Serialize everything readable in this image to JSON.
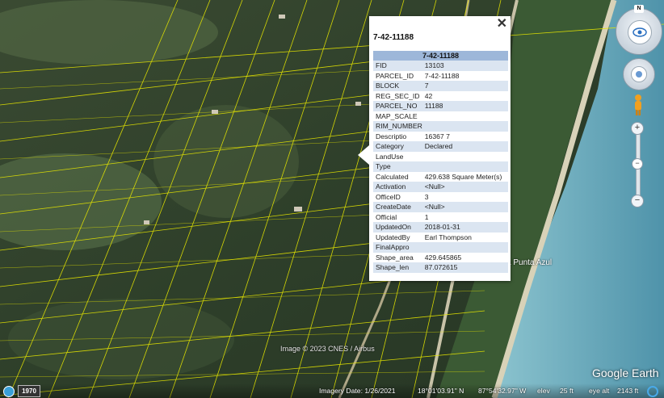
{
  "popup": {
    "heading": "7-42-11188",
    "table_header": "7-42-11188",
    "close_label": "✕",
    "rows": [
      {
        "key": "FID",
        "value": "13103"
      },
      {
        "key": "PARCEL_ID",
        "value": "7-42-11188"
      },
      {
        "key": "BLOCK",
        "value": "7"
      },
      {
        "key": "REG_SEC_ID",
        "value": "42"
      },
      {
        "key": "PARCEL_NO",
        "value": "11188"
      },
      {
        "key": "MAP_SCALE",
        "value": ""
      },
      {
        "key": "RIM_NUMBER",
        "value": ""
      },
      {
        "key": "Descriptio",
        "value": "16367 7"
      },
      {
        "key": "Category",
        "value": "Declared"
      },
      {
        "key": "LandUse",
        "value": ""
      },
      {
        "key": "Type",
        "value": ""
      },
      {
        "key": "Calculated",
        "value": "429.638 Square Meter(s)"
      },
      {
        "key": "Activation",
        "value": "<Null>"
      },
      {
        "key": "OfficeID",
        "value": "3"
      },
      {
        "key": "CreateDate",
        "value": "<Null>"
      },
      {
        "key": "Official",
        "value": "1"
      },
      {
        "key": "UpdatedOn",
        "value": "2018-01-31"
      },
      {
        "key": "UpdatedBy",
        "value": "Earl Thompson"
      },
      {
        "key": "FinalAppro",
        "value": ""
      },
      {
        "key": "Shape_area",
        "value": "429.645865"
      },
      {
        "key": "Shape_len",
        "value": "87.072615"
      }
    ]
  },
  "map": {
    "watermark": "Image © 2023 CNES / Airbus",
    "place_label": "a Punta Azul",
    "brand": "Google Earth",
    "compass_label": "N",
    "zoom_in": "+",
    "zoom_out": "−",
    "zoom_knob": "−"
  },
  "status": {
    "year": "1970",
    "imagery_date": "Imagery Date: 1/26/2021",
    "latitude": "18°01'03.91\" N",
    "longitude": "87°54'32.97\" W",
    "elev_label": "elev",
    "elev_value": "25 ft",
    "eye_alt_label": "eye alt",
    "eye_alt_value": "2143 ft"
  },
  "colors": {
    "parcel_lines": "#e6e600",
    "popup_header": "#9db7d9",
    "popup_alt_row": "#dbe5f1",
    "sea": "#5fa4b8"
  }
}
